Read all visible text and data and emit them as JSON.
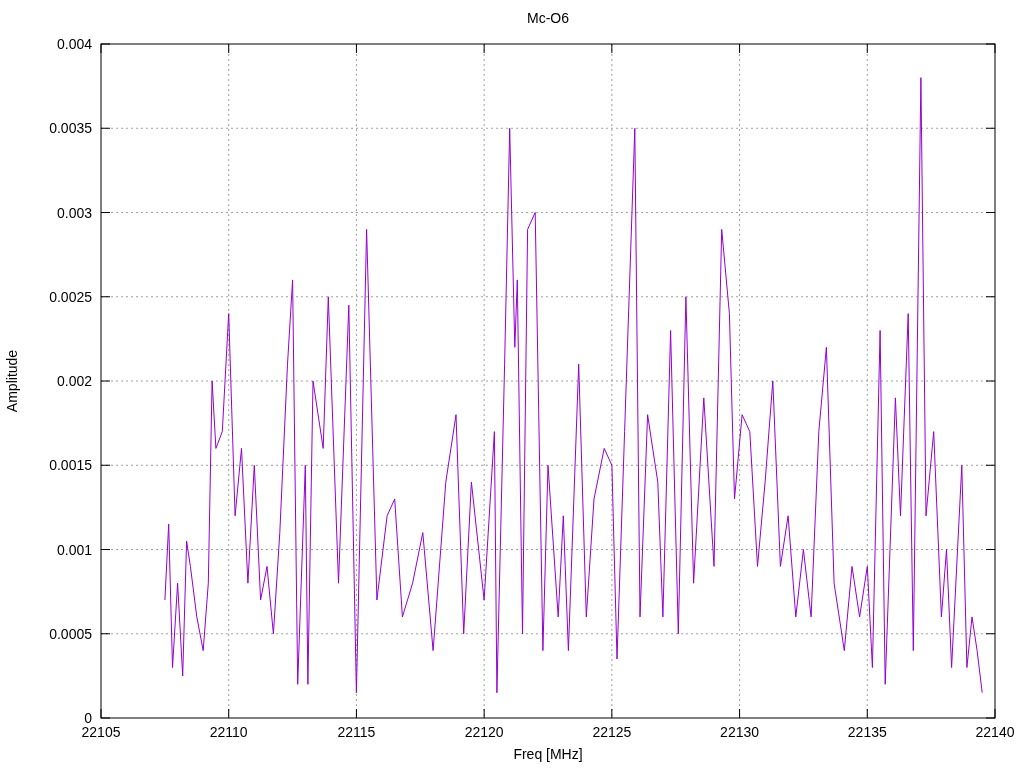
{
  "chart_data": {
    "type": "line",
    "title": "Mc-O6",
    "xlabel": "Freq [MHz]",
    "ylabel": "Amplitude",
    "x": [
      22107.5,
      22107.65,
      22107.8,
      22108.0,
      22108.2,
      22108.35,
      22108.5,
      22108.75,
      22109.0,
      22109.2,
      22109.35,
      22109.5,
      22109.75,
      22110.0,
      22110.25,
      22110.5,
      22110.75,
      22111.0,
      22111.25,
      22111.5,
      22111.75,
      22112.0,
      22112.3,
      22112.5,
      22112.7,
      22113.0,
      22113.1,
      22113.3,
      22113.7,
      22113.9,
      22114.3,
      22114.7,
      22115.0,
      22115.4,
      22115.8,
      22116.2,
      22116.5,
      22116.8,
      22117.2,
      22117.6,
      22118.0,
      22118.5,
      22118.9,
      22119.2,
      22119.5,
      22120.0,
      22120.4,
      22120.5,
      22120.8,
      22121.0,
      22121.2,
      22121.3,
      22121.5,
      22121.7,
      22122.0,
      22122.3,
      22122.5,
      22122.9,
      22123.1,
      22123.3,
      22123.7,
      22124.0,
      22124.3,
      22124.7,
      22125.0,
      22125.2,
      22125.5,
      22125.9,
      22126.1,
      22126.4,
      22126.8,
      22127.0,
      22127.3,
      22127.6,
      22127.9,
      22128.2,
      22128.6,
      22129.0,
      22129.3,
      22129.6,
      22129.8,
      22130.1,
      22130.4,
      22130.7,
      22131.0,
      22131.3,
      22131.6,
      22131.9,
      22132.2,
      22132.5,
      22132.8,
      22133.1,
      22133.4,
      22133.7,
      22134.1,
      22134.4,
      22134.7,
      22135.0,
      22135.2,
      22135.5,
      22135.7,
      22136.1,
      22136.3,
      22136.6,
      22136.8,
      22137.1,
      22137.3,
      22137.6,
      22137.9,
      22138.1,
      22138.3,
      22138.7,
      22138.9,
      22139.1,
      22139.3,
      22139.5
    ],
    "series": [
      {
        "color": "#9400d3",
        "values": [
          0.0007,
          0.00115,
          0.0003,
          0.0008,
          0.00025,
          0.00105,
          0.0009,
          0.0006,
          0.0004,
          0.0008,
          0.002,
          0.0016,
          0.0017,
          0.0024,
          0.0012,
          0.0016,
          0.0008,
          0.0015,
          0.0007,
          0.0009,
          0.0005,
          0.0011,
          0.0021,
          0.0026,
          0.0002,
          0.0015,
          0.0002,
          0.002,
          0.0016,
          0.0025,
          0.0008,
          0.00245,
          0.00015,
          0.0029,
          0.0007,
          0.0012,
          0.0013,
          0.0006,
          0.0008,
          0.0011,
          0.0004,
          0.0014,
          0.0018,
          0.0005,
          0.0014,
          0.0007,
          0.0017,
          0.00015,
          0.0021,
          0.0035,
          0.0022,
          0.0026,
          0.0005,
          0.0029,
          0.003,
          0.0004,
          0.0015,
          0.0006,
          0.0012,
          0.0004,
          0.0021,
          0.0006,
          0.0013,
          0.0016,
          0.0015,
          0.00035,
          0.0017,
          0.0035,
          0.0006,
          0.0018,
          0.0014,
          0.0006,
          0.0023,
          0.0005,
          0.0025,
          0.0008,
          0.0019,
          0.0009,
          0.0029,
          0.0024,
          0.0013,
          0.0018,
          0.0017,
          0.0009,
          0.0014,
          0.002,
          0.0009,
          0.0012,
          0.0006,
          0.001,
          0.0006,
          0.0017,
          0.0022,
          0.0008,
          0.0004,
          0.0009,
          0.0006,
          0.0009,
          0.0003,
          0.0023,
          0.0002,
          0.0019,
          0.0012,
          0.0024,
          0.0004,
          0.0038,
          0.0012,
          0.0017,
          0.0006,
          0.001,
          0.0003,
          0.0015,
          0.0003,
          0.0006,
          0.0004,
          0.00015
        ]
      }
    ],
    "grid": true,
    "xlim": [
      22105,
      22140
    ],
    "ylim": [
      0,
      0.004
    ],
    "xticks": [
      22105,
      22110,
      22115,
      22120,
      22125,
      22130,
      22135,
      22140
    ],
    "yticks": [
      0,
      0.0005,
      0.001,
      0.0015,
      0.002,
      0.0025,
      0.003,
      0.0035,
      0.004
    ]
  }
}
